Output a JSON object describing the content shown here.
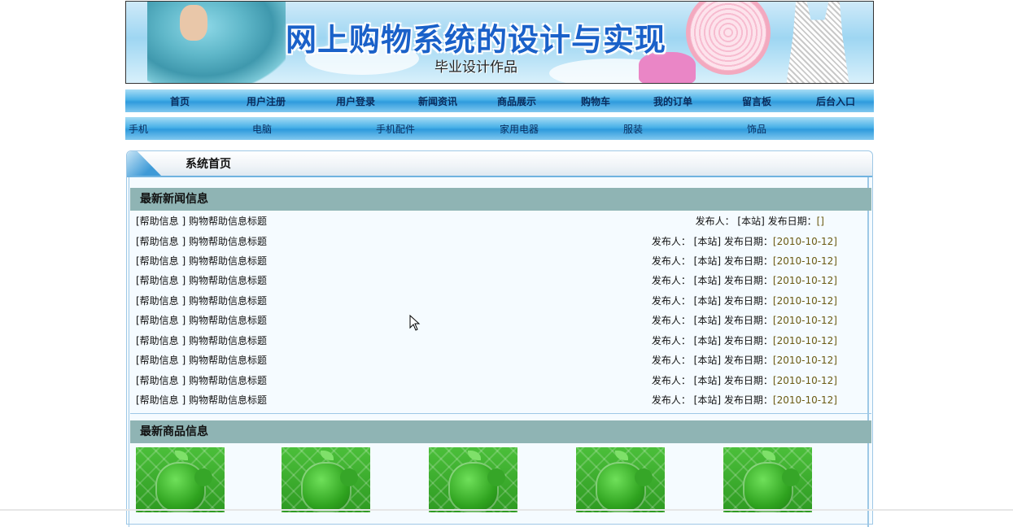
{
  "banner": {
    "title": "网上购物系统的设计与实现",
    "subtitle": "毕业设计作品"
  },
  "nav": {
    "items": [
      {
        "label": "首页"
      },
      {
        "label": "用户注册"
      },
      {
        "label": "用户登录"
      },
      {
        "label": "新闻资讯"
      },
      {
        "label": "商品展示"
      },
      {
        "label": "购物车"
      },
      {
        "label": "我的订单"
      },
      {
        "label": "留言板"
      },
      {
        "label": "后台入口"
      }
    ]
  },
  "categories": {
    "items": [
      {
        "label": "手机"
      },
      {
        "label": "电脑"
      },
      {
        "label": "手机配件"
      },
      {
        "label": "家用电器"
      },
      {
        "label": "服装"
      },
      {
        "label": "饰品"
      }
    ]
  },
  "panel": {
    "title": "系统首页"
  },
  "news": {
    "heading": "最新新闻信息",
    "publisher_label": "发布人：",
    "date_label": "发布日期：",
    "rows": [
      {
        "title": "[帮助信息 ] 购物帮助信息标题",
        "publisher": "[本站]",
        "date": "[]"
      },
      {
        "title": "[帮助信息 ] 购物帮助信息标题",
        "publisher": "[本站]",
        "date": "[2010-10-12]"
      },
      {
        "title": "[帮助信息 ] 购物帮助信息标题",
        "publisher": "[本站]",
        "date": "[2010-10-12]"
      },
      {
        "title": "[帮助信息 ] 购物帮助信息标题",
        "publisher": "[本站]",
        "date": "[2010-10-12]"
      },
      {
        "title": "[帮助信息 ] 购物帮助信息标题",
        "publisher": "[本站]",
        "date": "[2010-10-12]"
      },
      {
        "title": "[帮助信息 ] 购物帮助信息标题",
        "publisher": "[本站]",
        "date": "[2010-10-12]"
      },
      {
        "title": "[帮助信息 ] 购物帮助信息标题",
        "publisher": "[本站]",
        "date": "[2010-10-12]"
      },
      {
        "title": "[帮助信息 ] 购物帮助信息标题",
        "publisher": "[本站]",
        "date": "[2010-10-12]"
      },
      {
        "title": "[帮助信息 ] 购物帮助信息标题",
        "publisher": "[本站]",
        "date": "[2010-10-12]"
      },
      {
        "title": "[帮助信息 ] 购物帮助信息标题",
        "publisher": "[本站]",
        "date": "[2010-10-12]"
      }
    ]
  },
  "products": {
    "heading": "最新商品信息",
    "items": [
      {
        "icon": "apple-product-image"
      },
      {
        "icon": "apple-product-image"
      },
      {
        "icon": "apple-product-image"
      },
      {
        "icon": "apple-product-image"
      },
      {
        "icon": "apple-product-image"
      }
    ]
  },
  "colors": {
    "nav_blue": "#2f9bdd",
    "section_head": "#8fb4b4",
    "title_blue": "#1a61c9",
    "date_text": "#6b5a12"
  }
}
